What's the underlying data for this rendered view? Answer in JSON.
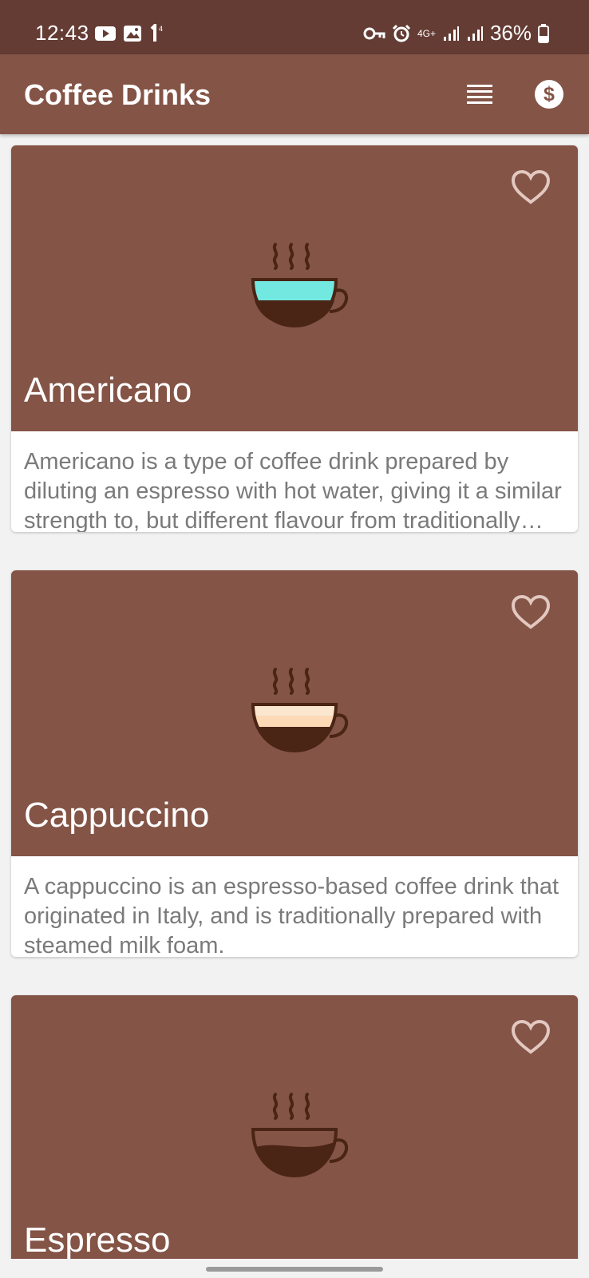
{
  "status_bar": {
    "time": "12:43",
    "notification_icons": [
      "youtube-icon",
      "gallery-icon",
      "data-arrow-icon"
    ],
    "system_icons": [
      "vpn-key-icon",
      "alarm-icon",
      "network-4g-icon",
      "signal-icon",
      "signal-icon",
      "battery-icon"
    ],
    "network_label": "4G+",
    "battery": "36%"
  },
  "app_bar": {
    "title": "Coffee Drinks",
    "actions": [
      "list-view-icon",
      "dollar-icon"
    ]
  },
  "colors": {
    "status_bar": "#643c34",
    "primary": "#845446",
    "cup_outline": "#4a2414",
    "coffee": "#4a2414",
    "water": "#72e8e0",
    "milk": "#fdd9b6",
    "foam": "#fbe7d0"
  },
  "drinks": [
    {
      "name": "Americano",
      "description": "Americano is a type of coffee drink prepared by diluting an espresso with hot water, giving it a similar strength to, but different flavour from traditionally brewed coffee.",
      "favorite": false,
      "icon": "americano-cup-icon"
    },
    {
      "name": "Cappuccino",
      "description": "A cappuccino is an espresso-based coffee drink that originated in Italy, and is traditionally prepared with steamed milk foam.",
      "favorite": false,
      "icon": "cappuccino-cup-icon"
    },
    {
      "name": "Espresso",
      "description": "",
      "favorite": false,
      "icon": "espresso-cup-icon"
    }
  ]
}
